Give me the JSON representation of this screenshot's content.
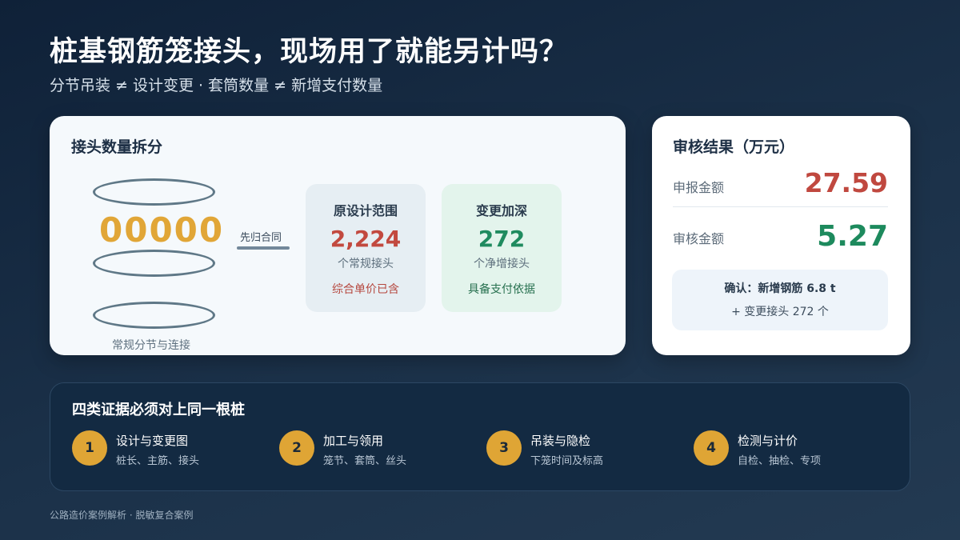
{
  "header": {
    "title": "桩基钢筋笼接头，现场用了就能另计吗？",
    "subtitle": "分节吊装 ≠ 设计变更 · 套筒数量 ≠ 新增支付数量"
  },
  "breakdown": {
    "title": "接头数量拆分",
    "joint_glyphs": "00000",
    "cage_caption": "常规分节与连接",
    "merge_label": "先归合同",
    "original": {
      "title": "原设计范围",
      "value": "2,224",
      "unit": "个常规接头",
      "note": "综合单价已含"
    },
    "change": {
      "title": "变更加深",
      "value": "272",
      "unit": "个净增接头",
      "note": "具备支付依据"
    }
  },
  "audit": {
    "title": "审核结果（万元）",
    "declared_label": "申报金额",
    "declared_value": "27.59",
    "audited_label": "审核金额",
    "audited_value": "5.27",
    "confirm_line1": "确认：新增钢筋 6.8 t",
    "confirm_line2": "+ 变更接头 272 个"
  },
  "evidence": {
    "title": "四类证据必须对上同一根桩",
    "steps": [
      {
        "num": "1",
        "title": "设计与变更图",
        "desc": "桩长、主筋、接头"
      },
      {
        "num": "2",
        "title": "加工与领用",
        "desc": "笼节、套筒、丝头"
      },
      {
        "num": "3",
        "title": "吊装与隐检",
        "desc": "下笼时间及标高"
      },
      {
        "num": "4",
        "title": "检测与计价",
        "desc": "自检、抽检、专项"
      }
    ]
  },
  "footer": "公路造价案例解析 · 脱敏复合案例",
  "colors": {
    "accent_gold": "#dfa535",
    "declared_red": "#c0483f",
    "audited_green": "#1d8a5d"
  }
}
